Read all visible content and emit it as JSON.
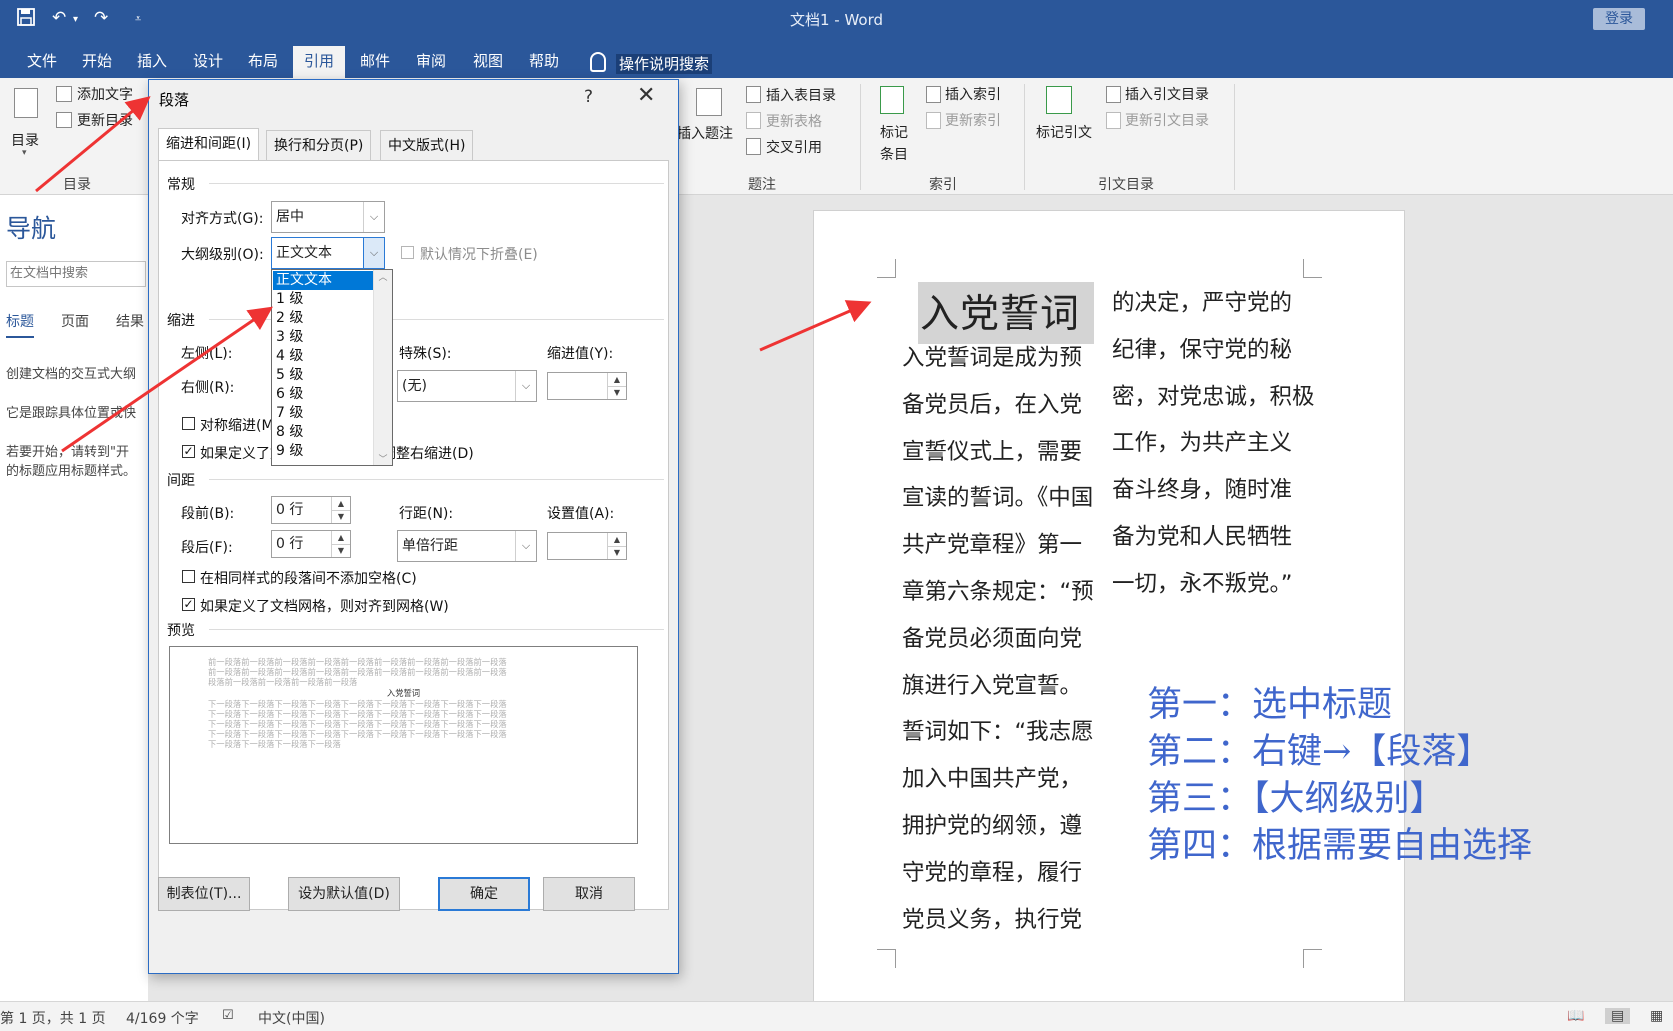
{
  "titlebar": {
    "title": "文档1  -  Word",
    "login": "登录"
  },
  "ribbon_tabs": [
    "文件",
    "开始",
    "插入",
    "设计",
    "布局",
    "引用",
    "邮件",
    "审阅",
    "视图",
    "帮助"
  ],
  "tell_me": "操作说明搜索",
  "ribbon": {
    "toc_label": "目录",
    "add_text": "添加文字",
    "update_toc": "更新目录",
    "group_toc": "目录",
    "insert_caption": "插入题注",
    "insert_table_of_figures": "插入表目录",
    "update_table": "更新表格",
    "cross_reference": "交叉引用",
    "group_captions": "题注",
    "mark_entry_1": "标记",
    "mark_entry_2": "条目",
    "insert_index": "插入索引",
    "update_index": "更新索引",
    "group_index": "索引",
    "mark_citation": "标记引文",
    "insert_table_of_authorities": "插入引文目录",
    "update_table_of_authorities": "更新引文目录",
    "group_toa": "引文目录"
  },
  "nav": {
    "title": "导航",
    "search_placeholder": "在文档中搜索",
    "tabs": [
      "标题",
      "页面",
      "结果"
    ],
    "text1": "创建文档的交互式大纲",
    "text2": "它是跟踪具体位置或快",
    "text3a": "若要开始，请转到\"开",
    "text3b": "的标题应用标题样式。"
  },
  "document": {
    "heading": "入党誓词",
    "col1": [
      "入党誓词是成为预",
      "备党员后，在入党",
      "宣誓仪式上，需要",
      "宣读的誓词。《中国",
      "共产党章程》第一",
      "章第六条规定：“预",
      "备党员必须面向党",
      "旗进行入党宣誓。",
      "誓词如下：“我志愿",
      "加入中国共产党，",
      "拥护党的纲领，遵",
      "守党的章程，履行",
      "党员义务，执行党"
    ],
    "col2": [
      "的决定，严守党的",
      "纪律，保守党的秘",
      "密，对党忠诚，积极",
      "工作，为共产主义",
      "奋斗终身，随时准",
      "备为党和人民牺牲",
      "一切，永不叛党。”"
    ],
    "annotation": [
      "第一：选中标题",
      "第二：右键→【段落】",
      "第三：【大纲级别】",
      "第四：根据需要自由选择"
    ]
  },
  "dialog": {
    "title": "段落",
    "help": "?",
    "tabs": [
      "缩进和间距(I)",
      "换行和分页(P)",
      "中文版式(H)"
    ],
    "general": "常规",
    "alignment_label": "对齐方式(G):",
    "alignment_value": "居中",
    "outline_label": "大纲级别(O):",
    "outline_value": "正文文本",
    "collapse_label": "默认情况下折叠(E)",
    "indent": "缩进",
    "left_label": "左侧(L):",
    "right_label": "右侧(R):",
    "special_label": "特殊(S):",
    "special_value": "(无)",
    "indent_by_label": "缩进值(Y):",
    "mirror_label": "对称缩进(M)",
    "auto_adjust_label": "如果定义了文档网格，则自动调整右缩进(D)",
    "spacing": "间距",
    "before_label": "段前(B):",
    "before_value": "0 行",
    "after_label": "段后(F):",
    "after_value": "0 行",
    "line_spacing_label": "行距(N):",
    "line_spacing_value": "单倍行距",
    "at_label": "设置值(A):",
    "no_space_label": "在相同样式的段落间不添加空格(C)",
    "snap_grid_label": "如果定义了文档网格，则对齐到网格(W)",
    "preview": "预览",
    "preview_prev": [
      "前一段落前一段落前一段落前一段落前一段落前一段落前一段落前一段落前一段落",
      "前一段落前一段落前一段落前一段落前一段落前一段落前一段落前一段落前一段落",
      "段落前一段落前一段落前一段落前一段落"
    ],
    "preview_title": "入党誓词",
    "preview_next": [
      "下一段落下一段落下一段落下一段落下一段落下一段落下一段落下一段落下一段落",
      "下一段落下一段落下一段落下一段落下一段落下一段落下一段落下一段落下一段落",
      "下一段落下一段落下一段落下一段落下一段落下一段落下一段落下一段落下一段落",
      "下一段落下一段落下一段落下一段落下一段落下一段落下一段落下一段落下一段落",
      "下一段落下一段落下一段落下一段落"
    ],
    "dropdown_items": [
      "正文文本",
      "1 级",
      "2 级",
      "3 级",
      "4 级",
      "5 级",
      "6 级",
      "7 级",
      "8 级",
      "9 级"
    ],
    "btn_tabs": "制表位(T)...",
    "btn_default": "设为默认值(D)",
    "btn_ok": "确定",
    "btn_cancel": "取消"
  },
  "status": {
    "page": "第 1 页，共 1 页",
    "words": "4/169 个字",
    "language": "中文(中国)"
  },
  "colors": {
    "accent": "#2b579a",
    "annotation": "#3f66cc",
    "arrow": "#ee3333",
    "selection": "#0078d7"
  }
}
